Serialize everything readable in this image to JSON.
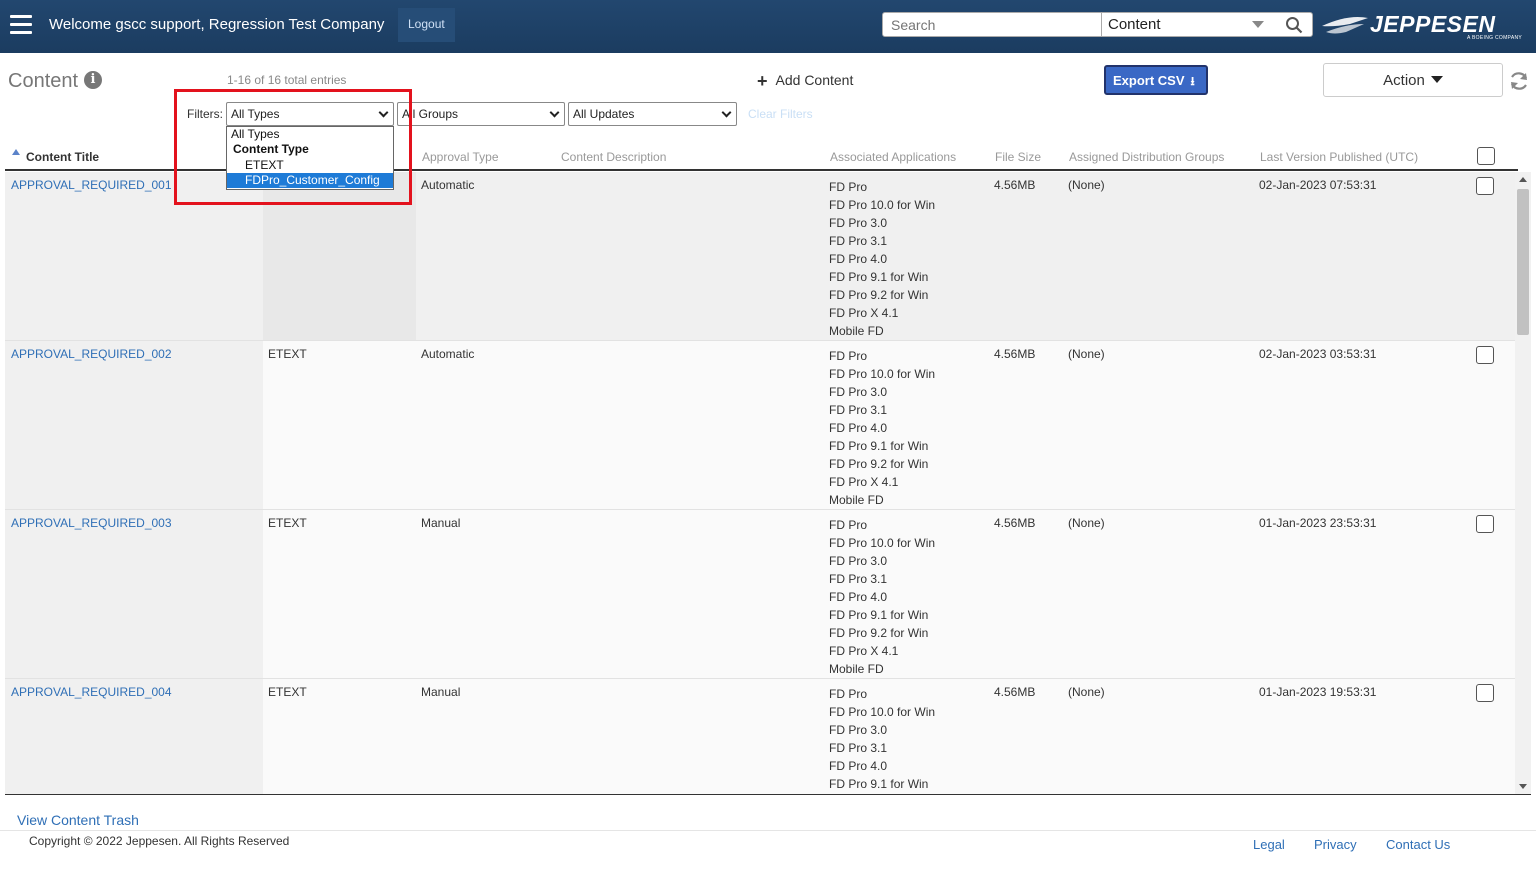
{
  "header": {
    "welcome": "Welcome gscc support, Regression Test Company",
    "logout": "Logout",
    "search_placeholder": "Search",
    "scope": "Content",
    "logo": "JEPPESEN",
    "logo_sub": "A BOEING COMPANY"
  },
  "toolbar": {
    "title": "Content",
    "entries": "1-16 of 16 total entries",
    "add_content": "Add Content",
    "export_csv": "Export CSV",
    "action": "Action"
  },
  "filters": {
    "label": "Filters:",
    "types": "All Types",
    "groups": "All Groups",
    "updates": "All Updates",
    "clear": "Clear Filters",
    "dropdown": {
      "all": "All Types",
      "group_label": "Content Type",
      "options": [
        "ETEXT",
        "FDPro_Customer_Config"
      ]
    }
  },
  "table": {
    "columns": {
      "title": "Content Title",
      "approval": "Approval Type",
      "description": "Content Description",
      "apps": "Associated Applications",
      "size": "File Size",
      "groups": "Assigned Distribution Groups",
      "published": "Last Version Published (UTC)"
    },
    "rows": [
      {
        "title": "APPROVAL_REQUIRED_001",
        "type": "",
        "approval": "Automatic",
        "size": "4.56MB",
        "groups": "(None)",
        "published": "02-Jan-2023 07:53:31",
        "apps": [
          "FD Pro",
          "FD Pro 10.0 for Win",
          "FD Pro 3.0",
          "FD Pro 3.1",
          "FD Pro 4.0",
          "FD Pro 9.1 for Win",
          "FD Pro 9.2 for Win",
          "FD Pro X 4.1",
          "Mobile FD"
        ]
      },
      {
        "title": "APPROVAL_REQUIRED_002",
        "type": "ETEXT",
        "approval": "Automatic",
        "size": "4.56MB",
        "groups": "(None)",
        "published": "02-Jan-2023 03:53:31",
        "apps": [
          "FD Pro",
          "FD Pro 10.0 for Win",
          "FD Pro 3.0",
          "FD Pro 3.1",
          "FD Pro 4.0",
          "FD Pro 9.1 for Win",
          "FD Pro 9.2 for Win",
          "FD Pro X 4.1",
          "Mobile FD"
        ]
      },
      {
        "title": "APPROVAL_REQUIRED_003",
        "type": "ETEXT",
        "approval": "Manual",
        "size": "4.56MB",
        "groups": "(None)",
        "published": "01-Jan-2023 23:53:31",
        "apps": [
          "FD Pro",
          "FD Pro 10.0 for Win",
          "FD Pro 3.0",
          "FD Pro 3.1",
          "FD Pro 4.0",
          "FD Pro 9.1 for Win",
          "FD Pro 9.2 for Win",
          "FD Pro X 4.1",
          "Mobile FD"
        ]
      },
      {
        "title": "APPROVAL_REQUIRED_004",
        "type": "ETEXT",
        "approval": "Manual",
        "size": "4.56MB",
        "groups": "(None)",
        "published": "01-Jan-2023 19:53:31",
        "apps": [
          "FD Pro",
          "FD Pro 10.0 for Win",
          "FD Pro 3.0",
          "FD Pro 3.1",
          "FD Pro 4.0",
          "FD Pro 9.1 for Win"
        ]
      }
    ]
  },
  "footer": {
    "trash": "View Content Trash",
    "copyright": "Copyright © 2022 Jeppesen. All Rights Reserved",
    "legal": "Legal",
    "privacy": "Privacy",
    "contact": "Contact Us"
  },
  "colors": {
    "header_bg": "#1b3c60",
    "link": "#2f6fb6",
    "export_bg": "#3a68c5",
    "highlight": "#e3121d",
    "dropdown_selected": "#1e7bd7"
  }
}
